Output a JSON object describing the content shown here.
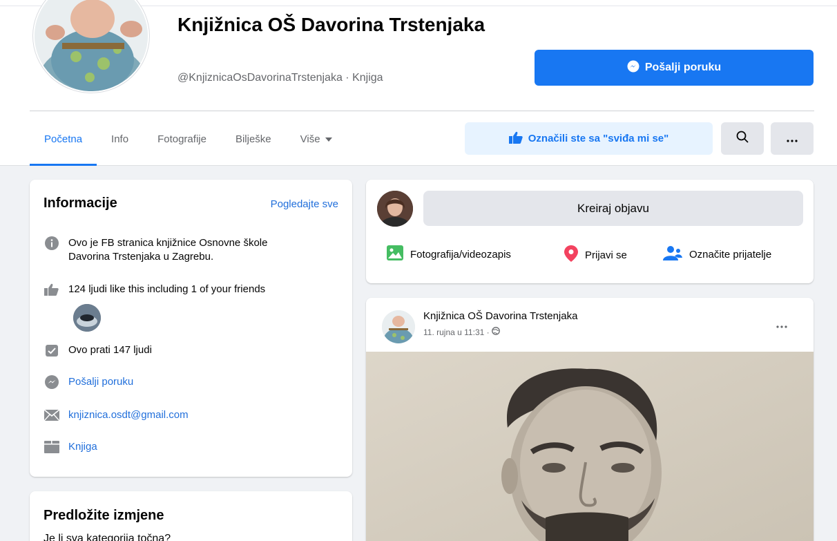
{
  "page": {
    "title": "Knjižnica OŠ Davorina Trstenjaka",
    "handle": "@KnjiznicaOsDavorinaTrstenjaka · Knjiga",
    "message_button": "Pošalji poruku"
  },
  "tabs": [
    {
      "label": "Početna"
    },
    {
      "label": "Info"
    },
    {
      "label": "Fotografije"
    },
    {
      "label": "Bilješke"
    },
    {
      "label": "Više"
    }
  ],
  "actions": {
    "liked_label": "Označili ste sa \"sviđa mi se\"",
    "search_icon": "search-icon",
    "more_icon": "more-icon"
  },
  "info_card": {
    "title": "Informacije",
    "see_all": "Pogledajte sve",
    "description": "Ovo je FB stranica knjižnice Osnovne škole Davorina Trstenjaka u Zagrebu.",
    "likes": "124 ljudi like this including 1 of your friends",
    "followers": "Ovo prati 147 ljudi",
    "send_message": "Pošalji poruku",
    "email": "knjiznica.osdt@gmail.com",
    "category": "Knjiga"
  },
  "suggest_card": {
    "title": "Predložite izmjene",
    "question": "Je li sva kategorija točna?"
  },
  "composer": {
    "placeholder": "Kreiraj objavu",
    "photo_video": "Fotografija/videozapis",
    "check_in": "Prijavi se",
    "tag_friends": "Označite prijatelje"
  },
  "post": {
    "author": "Knjižnica OŠ Davorina Trstenjaka",
    "time": "11. rujna u 11:31 ·"
  },
  "colors": {
    "accent": "#1877f2",
    "link": "#216fdb",
    "liked_bg": "#e7f3ff",
    "page_bg": "#f0f2f5"
  }
}
